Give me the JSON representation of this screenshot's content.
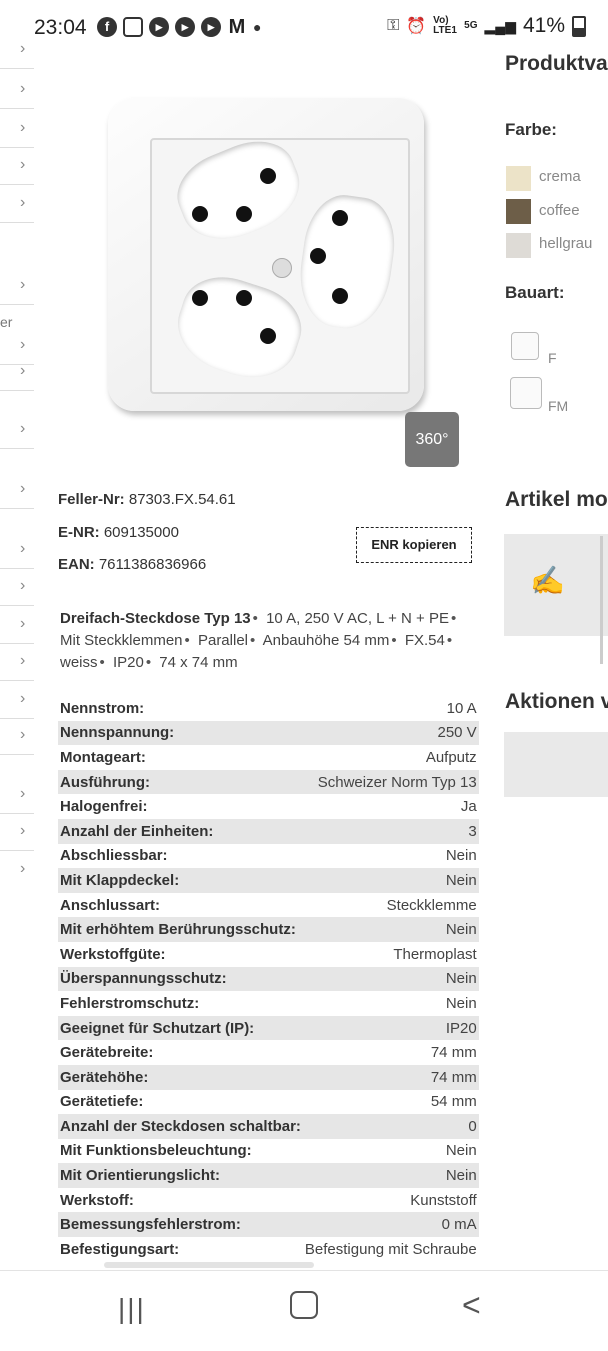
{
  "status": {
    "time": "23:04",
    "battery": "41%",
    "volte": "Vo) LTE1",
    "net": "5G"
  },
  "left_rail": {
    "partial_text": "er"
  },
  "product": {
    "view360_label": "360°"
  },
  "ids": {
    "feller_label": "Feller-Nr:",
    "feller_value": "87303.FX.54.61",
    "enr_label": "E-NR:",
    "enr_value": "609135000",
    "ean_label": "EAN:",
    "ean_value": "7611386836966",
    "copy_button": "ENR kopieren"
  },
  "description": {
    "title": "Dreifach-Steckdose Typ 13",
    "parts": [
      "10 A, 250 V AC, L + N + PE",
      "Mit Steckklemmen",
      "Parallel",
      "Anbauhöhe 54 mm",
      "FX.54",
      "weiss",
      "IP20",
      "74 x 74 mm"
    ]
  },
  "specs": [
    {
      "k": "Nennstrom:",
      "v": "10 A"
    },
    {
      "k": "Nennspannung:",
      "v": "250 V"
    },
    {
      "k": "Montageart:",
      "v": "Aufputz"
    },
    {
      "k": "Ausführung:",
      "v": "Schweizer Norm Typ 13"
    },
    {
      "k": "Halogenfrei:",
      "v": "Ja"
    },
    {
      "k": "Anzahl der Einheiten:",
      "v": "3"
    },
    {
      "k": "Abschliessbar:",
      "v": "Nein"
    },
    {
      "k": "Mit Klappdeckel:",
      "v": "Nein"
    },
    {
      "k": "Anschlussart:",
      "v": "Steckklemme"
    },
    {
      "k": "Mit erhöhtem Berührungsschutz:",
      "v": "Nein"
    },
    {
      "k": "Werkstoffgüte:",
      "v": "Thermoplast"
    },
    {
      "k": "Überspannungsschutz:",
      "v": "Nein"
    },
    {
      "k": "Fehlerstromschutz:",
      "v": "Nein"
    },
    {
      "k": "Geeignet für Schutzart (IP):",
      "v": "IP20"
    },
    {
      "k": "Gerätebreite:",
      "v": "74 mm"
    },
    {
      "k": "Gerätehöhe:",
      "v": "74 mm"
    },
    {
      "k": "Gerätetiefe:",
      "v": "54 mm"
    },
    {
      "k": "Anzahl der Steckdosen schaltbar:",
      "v": "0"
    },
    {
      "k": "Mit Funktionsbeleuchtung:",
      "v": "Nein"
    },
    {
      "k": "Mit Orientierungslicht:",
      "v": "Nein"
    },
    {
      "k": "Werkstoff:",
      "v": "Kunststoff"
    },
    {
      "k": "Bemessungsfehlerstrom:",
      "v": "0 mA"
    },
    {
      "k": "Befestigungsart:",
      "v": "Befestigung mit Schraube"
    }
  ],
  "right_panel": {
    "heading_variants": "Produktva",
    "farbe_label": "Farbe:",
    "colors": [
      {
        "name": "crema",
        "hex": "#ece3c8"
      },
      {
        "name": "coffee",
        "hex": "#6d5e48"
      },
      {
        "name": "hellgrau",
        "hex": "#dedbd6"
      }
    ],
    "bauart_label": "Bauart:",
    "bauart": [
      {
        "label": "F"
      },
      {
        "label": "FM"
      }
    ],
    "artikel_heading": "Artikel mo",
    "aktionen_heading": "Aktionen v",
    "sign_icon": "✍"
  },
  "navbar": {
    "recent": "|||",
    "home": "○",
    "back": "<"
  }
}
